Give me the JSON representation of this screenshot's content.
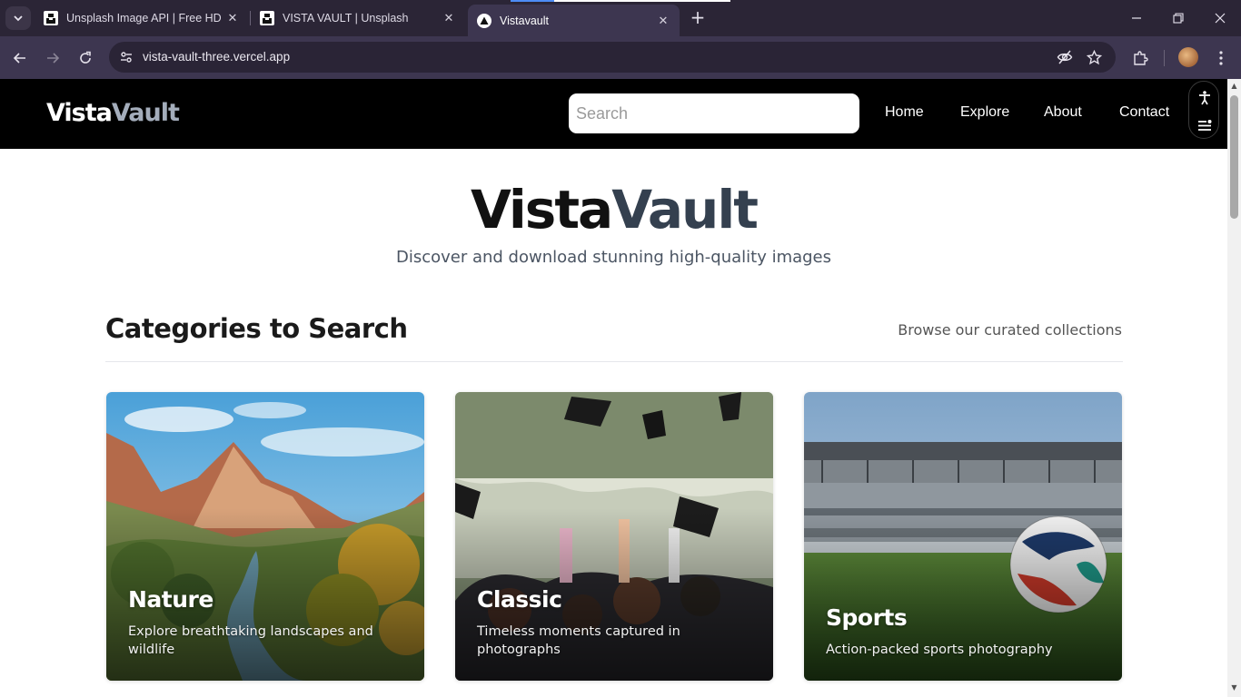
{
  "browser": {
    "tabs": [
      {
        "title": "Unsplash Image API | Free HD P",
        "active": false
      },
      {
        "title": "VISTA VAULT | Unsplash",
        "active": false
      },
      {
        "title": "Vistavault",
        "active": true
      }
    ],
    "url": "vista-vault-three.vercel.app"
  },
  "site": {
    "logo": {
      "part1": "Vista",
      "part2": "Vault"
    },
    "search_placeholder": "Search",
    "nav": [
      "Home",
      "Explore",
      "About",
      "Contact"
    ]
  },
  "hero": {
    "title_part1": "Vista",
    "title_part2": "Vault",
    "subtitle": "Discover and download stunning high-quality images"
  },
  "categories": {
    "heading": "Categories to Search",
    "link": "Browse our curated collections",
    "items": [
      {
        "title": "Nature",
        "description": "Explore breathtaking landscapes and wildlife"
      },
      {
        "title": "Classic",
        "description": "Timeless moments captured in photographs"
      },
      {
        "title": "Sports",
        "description": "Action-packed sports photography"
      }
    ]
  },
  "colors": {
    "nav_bg": "#000000",
    "logo_accent": "#a4adbb",
    "hero_accent": "#34404f",
    "browser_frame": "#2b2536"
  }
}
